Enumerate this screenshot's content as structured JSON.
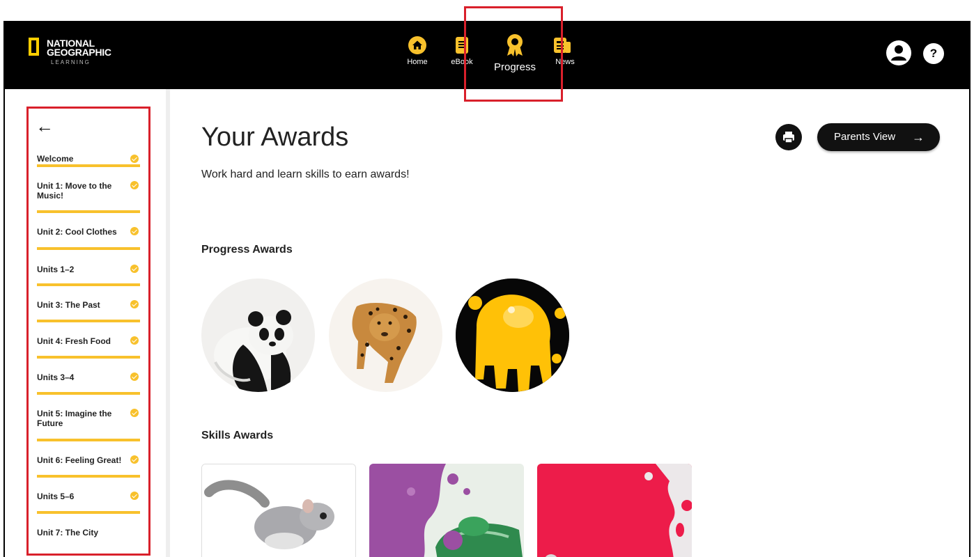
{
  "logo": {
    "line1": "NATIONAL",
    "line2": "GEOGRAPHIC",
    "line3": "LEARNING"
  },
  "nav": {
    "home": "Home",
    "ebook": "eBook",
    "progress": "Progress",
    "news": "News",
    "active": "Progress"
  },
  "header_icons": {
    "profile": "user-icon",
    "help": "?"
  },
  "sidebar": {
    "back_icon": "←",
    "units": [
      {
        "label": "Welcome",
        "completed": true
      },
      {
        "label": "Unit 1: Move to the Music!",
        "completed": true
      },
      {
        "label": "Unit 2: Cool Clothes",
        "completed": true
      },
      {
        "label": "Units 1–2",
        "completed": true
      },
      {
        "label": "Unit 3: The Past",
        "completed": true
      },
      {
        "label": "Unit 4: Fresh Food",
        "completed": true
      },
      {
        "label": "Units 3–4",
        "completed": true
      },
      {
        "label": "Unit 5: Imagine the Future",
        "completed": true
      },
      {
        "label": "Unit 6: Feeling Great!",
        "completed": true
      },
      {
        "label": "Units 5–6",
        "completed": true
      },
      {
        "label": "Unit 7: The City",
        "completed": false
      }
    ]
  },
  "main": {
    "title": "Your Awards",
    "subtitle": "Work hard and learn skills to earn awards!",
    "parents_view_label": "Parents View",
    "parents_view_arrow": "→",
    "progress_awards_title": "Progress Awards",
    "progress_awards": [
      "panda",
      "jaguar",
      "yellow-splash"
    ],
    "skills_awards_title": "Skills Awards",
    "skills_awards": [
      "sugar-glider",
      "chameleon",
      "pink-splash"
    ]
  },
  "colors": {
    "accent": "#f8c12c",
    "topbar": "#000000",
    "highlight": "#d9202b",
    "button": "#111111"
  }
}
